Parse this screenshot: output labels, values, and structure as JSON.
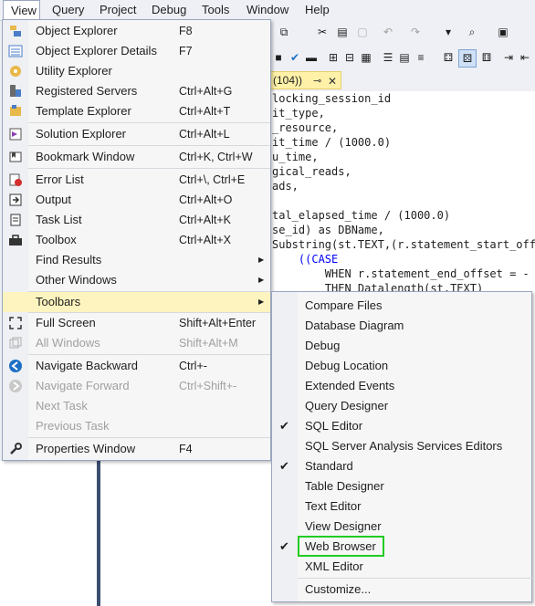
{
  "menubar": {
    "items": [
      {
        "label": "View",
        "active": true
      },
      {
        "label": "Query"
      },
      {
        "label": "Project"
      },
      {
        "label": "Debug"
      },
      {
        "label": "Tools"
      },
      {
        "label": "Window"
      },
      {
        "label": "Help"
      }
    ]
  },
  "document_tab": {
    "label": "(104))",
    "pin_glyph": "⊸",
    "close_glyph": "✕"
  },
  "code_lines": [
    "locking_session_id",
    "it_type,",
    "_resource,",
    "it_time / (1000.0)",
    "u_time,",
    "gical_reads,",
    "ads,",
    "",
    "tal_elapsed_time / (1000.0)",
    "se_id) as DBName,",
    "Substring(st.TEXT,(r.statement_start_offs",
    "    ((CASE",
    "        WHEN r.statement_end_offset = -",
    "        THEN Datalength(st.TEXT)"
  ],
  "view_menu": {
    "items": [
      {
        "icon": "object-explorer-icon",
        "label": "Object Explorer",
        "shortcut": "F8"
      },
      {
        "icon": "object-explorer-details-icon",
        "label": "Object Explorer Details",
        "shortcut": "F7"
      },
      {
        "icon": "utility-explorer-icon",
        "label": "Utility Explorer",
        "shortcut": ""
      },
      {
        "icon": "registered-servers-icon",
        "label": "Registered Servers",
        "shortcut": "Ctrl+Alt+G"
      },
      {
        "icon": "template-explorer-icon",
        "label": "Template Explorer",
        "shortcut": "Ctrl+Alt+T"
      },
      {
        "icon": "solution-explorer-icon",
        "label": "Solution Explorer",
        "shortcut": "Ctrl+Alt+L"
      },
      {
        "icon": "bookmark-window-icon",
        "label": "Bookmark Window",
        "shortcut": "Ctrl+K, Ctrl+W"
      },
      {
        "icon": "error-list-icon",
        "label": "Error List",
        "shortcut": "Ctrl+\\, Ctrl+E"
      },
      {
        "icon": "output-icon",
        "label": "Output",
        "shortcut": "Ctrl+Alt+O"
      },
      {
        "icon": "task-list-icon",
        "label": "Task List",
        "shortcut": "Ctrl+Alt+K"
      },
      {
        "icon": "toolbox-icon",
        "label": "Toolbox",
        "shortcut": "Ctrl+Alt+X"
      },
      {
        "icon": "",
        "label": "Find Results",
        "shortcut": "",
        "submenu": true
      },
      {
        "icon": "",
        "label": "Other Windows",
        "shortcut": "",
        "submenu": true
      },
      {
        "icon": "",
        "label": "Toolbars",
        "shortcut": "",
        "submenu": true,
        "highlight": true
      },
      {
        "icon": "full-screen-icon",
        "label": "Full Screen",
        "shortcut": "Shift+Alt+Enter"
      },
      {
        "icon": "all-windows-icon",
        "label": "All Windows",
        "shortcut": "Shift+Alt+M",
        "disabled": true
      },
      {
        "icon": "navigate-backward-icon",
        "label": "Navigate Backward",
        "shortcut": "Ctrl+-"
      },
      {
        "icon": "navigate-forward-icon",
        "label": "Navigate Forward",
        "shortcut": "Ctrl+Shift+-",
        "disabled": true
      },
      {
        "icon": "",
        "label": "Next Task",
        "shortcut": "",
        "disabled": true
      },
      {
        "icon": "",
        "label": "Previous Task",
        "shortcut": "",
        "disabled": true
      },
      {
        "icon": "properties-window-icon",
        "label": "Properties Window",
        "shortcut": "F4"
      }
    ]
  },
  "toolbars_submenu": {
    "items": [
      {
        "label": "Compare Files",
        "checked": false
      },
      {
        "label": "Database Diagram",
        "checked": false
      },
      {
        "label": "Debug",
        "checked": false
      },
      {
        "label": "Debug Location",
        "checked": false
      },
      {
        "label": "Extended Events",
        "checked": false
      },
      {
        "label": "Query Designer",
        "checked": false
      },
      {
        "label": "SQL Editor",
        "checked": true
      },
      {
        "label": "SQL Server Analysis Services Editors",
        "checked": false
      },
      {
        "label": "Standard",
        "checked": true
      },
      {
        "label": "Table Designer",
        "checked": false
      },
      {
        "label": "Text Editor",
        "checked": false
      },
      {
        "label": "View Designer",
        "checked": false
      },
      {
        "label": "Web Browser",
        "checked": true,
        "highlighted_box": true
      },
      {
        "label": "XML Editor",
        "checked": false
      },
      {
        "label": "Customize...",
        "checked": false
      }
    ],
    "check_glyph": "✔"
  },
  "colors": {
    "menu_highlight": "#fdf4bf",
    "keyword": "#0000ff",
    "function": "#c71585",
    "annotation_box": "#22cc22",
    "tab_active": "#fff1a8"
  }
}
